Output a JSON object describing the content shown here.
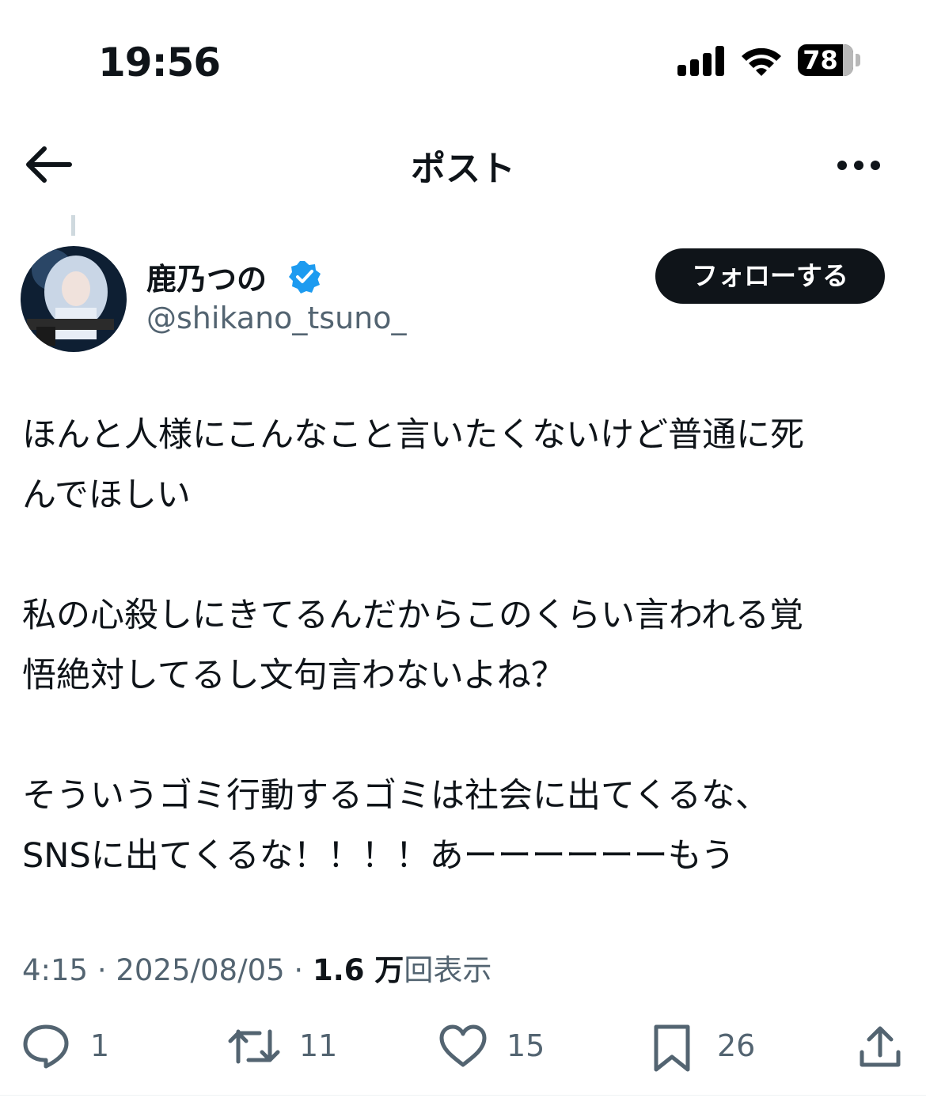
{
  "status_bar": {
    "time": "19:56",
    "battery": "78"
  },
  "nav": {
    "title": "ポスト"
  },
  "author": {
    "display_name": "鹿乃つの",
    "handle": "@shikano_tsuno_",
    "follow_label": "フォローする"
  },
  "post": {
    "paragraphs": [
      "ほんと人様にこんなこと言いたくないけど普通に死\nんでほしい",
      "私の心殺しにきてるんだからこのくらい言われる覚\n悟絶対してるし文句言わないよね？",
      "そういうゴミ行動するゴミは社会に出てくるな、\nSNSに出てくるな！！！！あーーーーーーもう"
    ],
    "time": "4:15",
    "date": "2025/08/05",
    "views_count": "1.6 万",
    "views_label": "回表示"
  },
  "actions": {
    "replies": "1",
    "reposts": "11",
    "likes": "15",
    "bookmarks": "26"
  },
  "colors": {
    "text": "#0f1419",
    "secondary": "#536471",
    "verified": "#1d9bf0",
    "follow_bg": "#0f1419"
  }
}
